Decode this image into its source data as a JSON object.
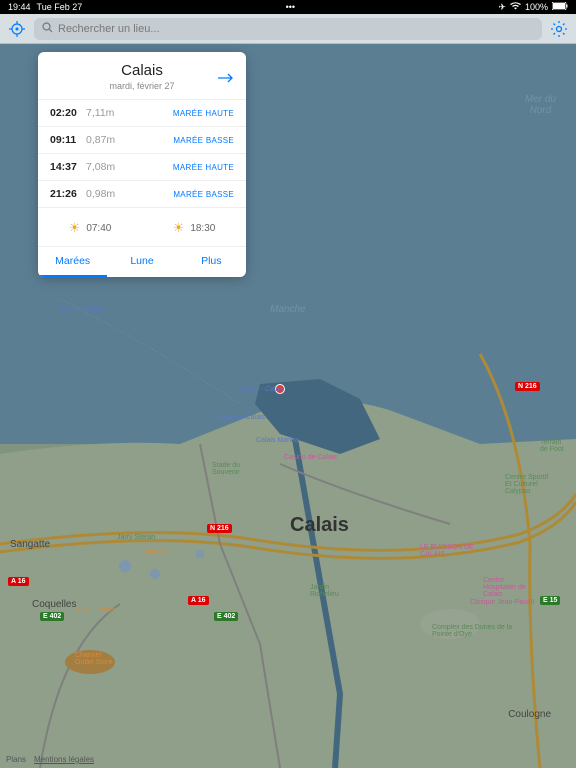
{
  "status": {
    "time": "19:44",
    "date": "Tue Feb 27",
    "wifi": "100%"
  },
  "toolbar": {
    "search_placeholder": "Rechercher un lieu..."
  },
  "map": {
    "sea_labels": {
      "north_sea": "Mer du\nNord",
      "channel": "Manche"
    },
    "city_main": "Calais",
    "cities": {
      "coquelles": "Coquelles",
      "coulogne": "Coulogne",
      "sangatte": "Sangatte"
    },
    "roads": {
      "a16_1": "A 16",
      "a16_2": "A 16",
      "e402_1": "E 402",
      "e402_2": "E 402",
      "e15": "E 15",
      "n216_1": "N 216",
      "n216_2": "N 216"
    },
    "poi": {
      "plage": "Plage de Calais",
      "marina": "Calais Marina",
      "casino": "Casino de Calais",
      "stade": "Stade du\nSouvenir",
      "centre": "Centre Sportif\nEt Culturel\nCalypso",
      "hospitalier": "Centre\nHospitalier de\nCalais",
      "buisson": "LE BUISSON DE\nCALAIS",
      "jarry": "Jarry Steran",
      "auchan": "Auchan",
      "cite": "Cité Europé",
      "channel_outlet": "Channel\nOutlet Store",
      "jph": "Clinique Jean-Paul II",
      "jericho": "Jardin\nRichelieu",
      "dunes": "Complex des Dunes de la\nPointe d'Oye",
      "terrain": "Terrain\nde Foot",
      "dover": "Dover - Calais",
      "dover2": "Dover - Calais"
    },
    "attribution": {
      "plans": "Plans",
      "legal": "Mentions légales"
    }
  },
  "card": {
    "title": "Calais",
    "date": "mardi, février 27",
    "tides": [
      {
        "time": "02:20",
        "height": "7,11m",
        "type": "MARÉE HAUTE"
      },
      {
        "time": "09:11",
        "height": "0,87m",
        "type": "MARÉE BASSE"
      },
      {
        "time": "14:37",
        "height": "7,08m",
        "type": "MARÉE HAUTE"
      },
      {
        "time": "21:26",
        "height": "0,98m",
        "type": "MARÉE BASSE"
      }
    ],
    "sun": {
      "rise": "07:40",
      "set": "18:30"
    },
    "tabs": {
      "marees": "Marées",
      "lune": "Lune",
      "plus": "Plus"
    }
  }
}
